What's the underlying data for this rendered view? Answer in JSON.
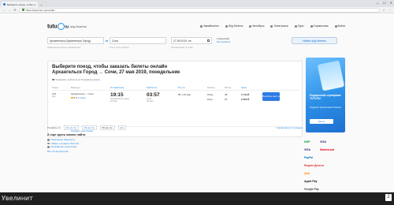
{
  "browser": {
    "tab_title": "Выберите поезд, чтобы за",
    "tab_close": "×",
    "new_tab": "+",
    "win_controls": [
      "—",
      "☐",
      "✕"
    ],
    "url": "https://www.tutu.ru/poezda/...",
    "nav": [
      "←",
      "→",
      "⟳"
    ],
    "right_icons": [
      "☆",
      "⋮"
    ]
  },
  "header": {
    "logo": "tutu",
    "logo_tld": "ru",
    "logo_sub": "ж/д билеты",
    "nav": [
      "Авиабилеты",
      "Ж/д билеты",
      "Автобусы",
      "Электрички",
      "Туры",
      "Справочная",
      "Войти"
    ]
  },
  "search": {
    "from": "Архангельск (Архангельск Город)",
    "from_hint": "Архангельск-Город, Архангельск",
    "swap": "⇄",
    "to": "Сочи",
    "to_hint": "Сочи, Сочи, Адлер",
    "date": "27.05.2019, пн",
    "date_hint": "Понедельник, 27 мая",
    "pax_line1": "1 взрослый",
    "pax_line2": "Без ребёнка",
    "button": "Найти ж/д билеты"
  },
  "results": {
    "title_line1": "Выберите поезд, чтобы заказать билеты онлайн",
    "title_line2": "Архангельск Город → Сочи, 27 мая 2019, понедельник",
    "note": "Показывать прибытие на ближайшее время",
    "columns": {
      "train": "Поезд",
      "route": "Маршрут",
      "departure": "Отправление",
      "arrival": "Прибытие",
      "duration": "В пути",
      "class": "Классы",
      "seats": "Места",
      "price": "Цена"
    },
    "row": {
      "train_num": "124",
      "train_sub": "Ару",
      "route_from": "Архангельск",
      "route_to": "Сочи",
      "rating": "3,6",
      "reviews": "отзывы",
      "dep_time": "19:15",
      "dep_station": "Архангельск-Город",
      "dep_date": "27 мая",
      "arr_time": "03:57",
      "arr_station": "Сочи",
      "arr_date": "30 мая",
      "duration": "56 ч 42 мин",
      "seats_1": "Плац",
      "seats_1_n": "48",
      "seats_2": "Купе",
      "seats_2_n": "15",
      "price_1": "5 143 ₽",
      "price_2": "8 262 ₽",
      "choose": "Выбрать места"
    },
    "more": "Показать ещё поезда"
  },
  "promo": {
    "line1": "Подарочный сертификат TUTU.RU",
    "line2": "Подарите впечатления близким",
    "button": "Купить"
  },
  "pager": {
    "label": "Показать по",
    "options": [
      "10 на стр",
      "20 на стр",
      "50 на стр",
      "все"
    ],
    "selected_index": 2,
    "right_link": "Справочная по поездам"
  },
  "howto": {
    "title": "А еще здесь можно найти",
    "items": [
      "Изменение маршрута",
      "Обмен и возврат билетов",
      "Ближайшие электрички"
    ],
    "all": "Все об ж/д билетах"
  },
  "payments": [
    "МИР",
    "VISA",
    "VISA",
    "Mastercard",
    "PayPal",
    "Яндекс.Деньги",
    "Qiwi",
    "Apple Pay",
    "Google Pay",
    "Visa"
  ],
  "taskbar": {
    "label": "Увелинит",
    "tray": "2"
  },
  "colors": {
    "accent": "#2c7be5",
    "link": "#1e88e5",
    "taskbar": "#1f1f1f"
  }
}
